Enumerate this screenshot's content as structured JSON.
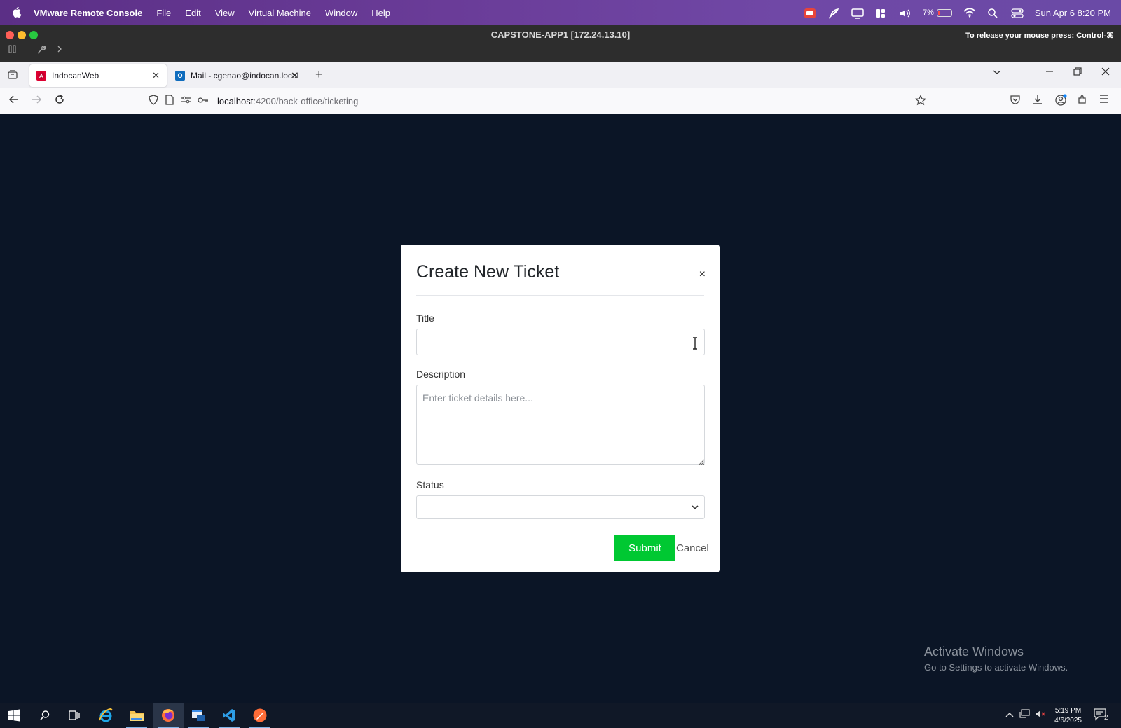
{
  "mac_menubar": {
    "app_name": "VMware Remote Console",
    "menus": [
      "File",
      "Edit",
      "View",
      "Virtual Machine",
      "Window",
      "Help"
    ],
    "battery_percent": "7%",
    "datetime": "Sun Apr 6  8:20 PM"
  },
  "vm_window": {
    "title": "CAPSTONE-APP1 [172.24.13.10]",
    "release_hint": "To release your mouse press: Control-⌘"
  },
  "browser": {
    "tabs": [
      {
        "label": "IndocanWeb",
        "active": true
      },
      {
        "label": "Mail - cgenao@indocan.local",
        "active": false
      }
    ],
    "url_host": "localhost",
    "url_path": ":4200/back-office/ticketing"
  },
  "modal": {
    "title": "Create New Ticket",
    "close_symbol": "×",
    "title_label": "Title",
    "title_value": "",
    "description_label": "Description",
    "description_placeholder": "Enter ticket details here...",
    "status_label": "Status",
    "status_value": "",
    "submit_label": "Submit",
    "cancel_label": "Cancel"
  },
  "watermark": {
    "line1": "Activate Windows",
    "line2": "Go to Settings to activate Windows."
  },
  "taskbar": {
    "time": "5:19 PM",
    "date": "4/6/2025",
    "notification_count": "2"
  },
  "colors": {
    "page_bg": "#0b1526",
    "submit_bg": "#00c832",
    "menubar_purple": "#6a3c98"
  }
}
